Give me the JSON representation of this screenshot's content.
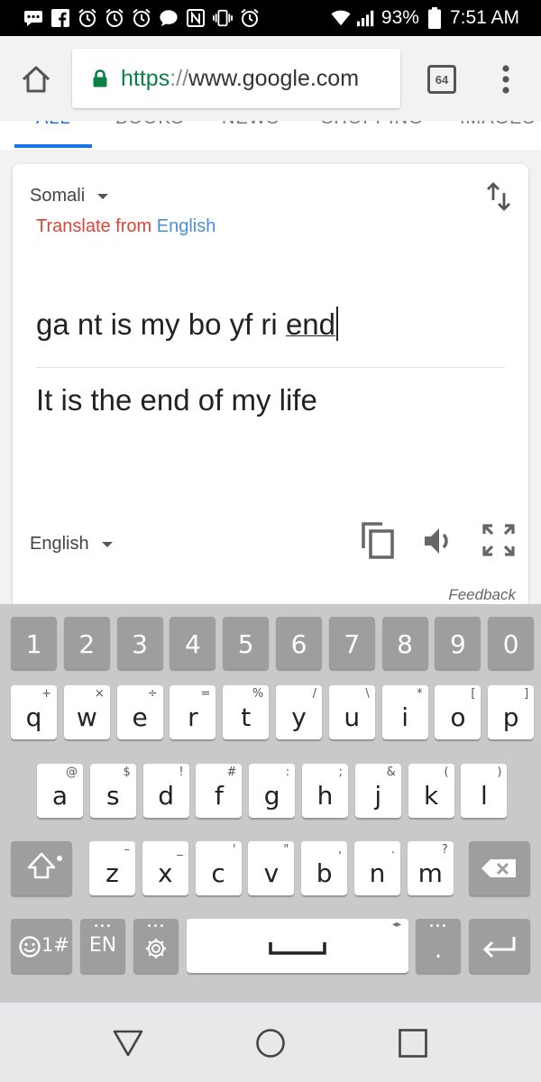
{
  "status_bar": {
    "battery_pct": "93%",
    "time": "7:51 AM",
    "icons": [
      "messages-icon",
      "facebook-icon",
      "alarm-icon",
      "alarm-icon",
      "alarm-icon",
      "chat-bubble-icon",
      "nfc-icon",
      "vibrate-icon",
      "alarm-clock-icon",
      "wifi-icon",
      "signal-icon",
      "battery-icon"
    ]
  },
  "browser": {
    "url_scheme": "https",
    "url_sep": "://",
    "url_host": "www.google.com",
    "tab_count": "64"
  },
  "search_tabs": [
    "ALL",
    "BOOKS",
    "NEWS",
    "SHOPPING",
    "IMAGES"
  ],
  "translate": {
    "source_language": "Somali",
    "translate_from_label": "Translate from",
    "translate_from_language": "English",
    "input_text_before": "ga nt is my bo yf ri ",
    "input_text_composing": "end",
    "output_text": "It is the end of my life",
    "target_language": "English",
    "feedback_label": "Feedback"
  },
  "keyboard": {
    "numbers": [
      "1",
      "2",
      "3",
      "4",
      "5",
      "6",
      "7",
      "8",
      "9",
      "0"
    ],
    "row1": [
      {
        "key": "q",
        "sub": "+"
      },
      {
        "key": "w",
        "sub": "×"
      },
      {
        "key": "e",
        "sub": "÷"
      },
      {
        "key": "r",
        "sub": "="
      },
      {
        "key": "t",
        "sub": "%"
      },
      {
        "key": "y",
        "sub": "/"
      },
      {
        "key": "u",
        "sub": "\\"
      },
      {
        "key": "i",
        "sub": "*"
      },
      {
        "key": "o",
        "sub": "["
      },
      {
        "key": "p",
        "sub": "]"
      }
    ],
    "row2": [
      {
        "key": "a",
        "sub": "@"
      },
      {
        "key": "s",
        "sub": "$"
      },
      {
        "key": "d",
        "sub": "!"
      },
      {
        "key": "f",
        "sub": "#"
      },
      {
        "key": "g",
        "sub": ":"
      },
      {
        "key": "h",
        "sub": ";"
      },
      {
        "key": "j",
        "sub": "&"
      },
      {
        "key": "k",
        "sub": "("
      },
      {
        "key": "l",
        "sub": ")"
      }
    ],
    "row3": [
      {
        "key": "z",
        "sub": "–"
      },
      {
        "key": "x",
        "sub": "_"
      },
      {
        "key": "c",
        "sub": "'"
      },
      {
        "key": "v",
        "sub": "\""
      },
      {
        "key": "b",
        "sub": ","
      },
      {
        "key": "n",
        "sub": "."
      },
      {
        "key": "m",
        "sub": "?"
      }
    ],
    "symbols_label": "1#",
    "language_label": "EN",
    "period_label": "."
  }
}
